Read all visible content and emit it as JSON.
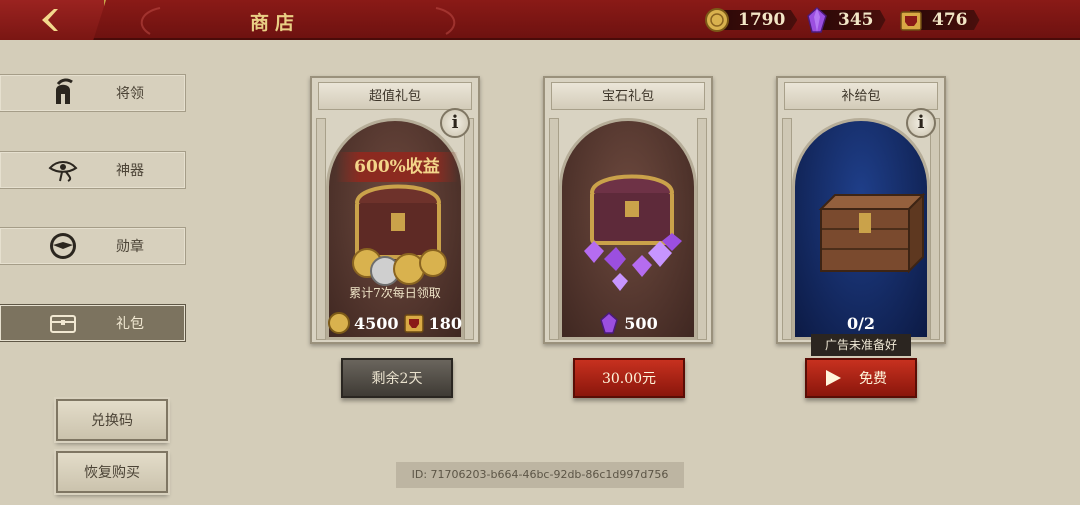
{
  "header": {
    "title": "商店"
  },
  "resources": [
    {
      "icon": "gold-coin-icon",
      "value": "1790"
    },
    {
      "icon": "purple-gem-icon",
      "value": "345"
    },
    {
      "icon": "spartan-helmet-token-icon",
      "value": "476"
    }
  ],
  "sidebar": {
    "items": [
      {
        "label": "将领",
        "icon": "spartan-helmet-icon"
      },
      {
        "label": "神器",
        "icon": "eye-of-horus-icon"
      },
      {
        "label": "勋章",
        "icon": "eagle-medal-icon"
      },
      {
        "label": "礼包",
        "icon": "chest-icon",
        "active": true
      }
    ],
    "redeem_label": "兑换码",
    "restore_label": "恢复购买"
  },
  "cards": [
    {
      "title": "超值礼包",
      "ribbon": "600%收益",
      "subtitle": "累计7次每日领取",
      "rewards": [
        {
          "icon": "gold-coin-icon",
          "amount": "4500"
        },
        {
          "icon": "spartan-helmet-token-icon",
          "amount": "180"
        }
      ],
      "button_label": "剩余2天"
    },
    {
      "title": "宝石礼包",
      "rewards": [
        {
          "icon": "purple-gem-icon",
          "amount": "500"
        }
      ],
      "button_label": "30.00元"
    },
    {
      "title": "补给包",
      "progress": "0/2",
      "tooltip": "广告未准备好",
      "button_label": "免费"
    }
  ],
  "footer": {
    "id_text": "ID: 71706203-b664-46bc-92db-86c1d997d756"
  },
  "colors": {
    "header_red": "#7a1613",
    "gold_text": "#e9cf85",
    "button_red": "#b02517",
    "background": "#d4cdb9"
  }
}
